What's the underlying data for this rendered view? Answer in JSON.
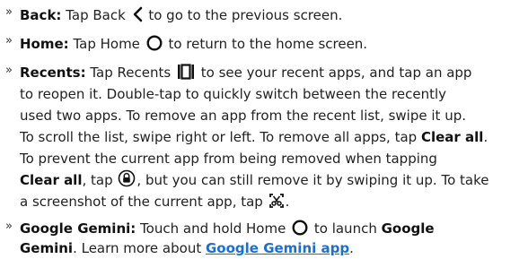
{
  "bullets": {
    "back": {
      "marker": "»",
      "title": "Back:",
      "before": "Tap Back",
      "after": "to go to the previous screen.",
      "icon": "back-chevron-icon"
    },
    "home": {
      "marker": "»",
      "title": "Home:",
      "before": "Tap Home",
      "after": "to return to the home screen.",
      "icon": "home-circle-icon"
    },
    "recents": {
      "marker": "»",
      "title": "Recents:",
      "l1_before": "Tap Recents",
      "l1_after": "to see your recent apps, and tap an app",
      "l2": "to reopen it. Double-tap to quickly switch between the recently",
      "l3": "used two apps. To remove an app from the recent list, swipe it up.",
      "l4_before": "To scroll the list, swipe right or left. To remove all apps, tap",
      "l4_bold": "Clear all",
      "l4_after": ".",
      "l5": "To prevent the current app from being removed when tapping",
      "l6_bold": "Clear all",
      "l6_mid": ", tap",
      "l6_after": ", but you can still remove it by swiping it up. To take",
      "l7_before": "a screenshot of the current app, tap",
      "l7_after": ".",
      "icon_recents": "recents-icon",
      "icon_lock": "lock-app-icon",
      "icon_screenshot": "screenshot-icon"
    },
    "gemini": {
      "marker": "»",
      "title": "Google Gemini:",
      "l1_before": "Touch and hold Home",
      "l1_after": "to launch",
      "l1_bold": "Google",
      "l2_bold": "Gemini",
      "l2_mid": ". Learn more about",
      "l2_link": "Google Gemini app",
      "l2_after": ".",
      "icon": "home-circle-icon"
    }
  },
  "colors": {
    "text": "#222222",
    "link": "#1a6fd6"
  }
}
